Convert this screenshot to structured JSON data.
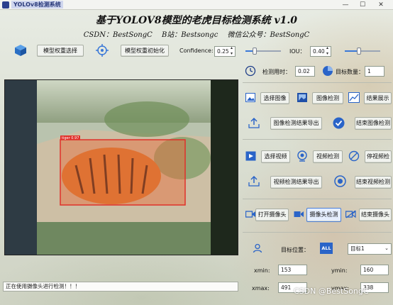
{
  "window": {
    "title": "YOLOv8检测系统"
  },
  "header": {
    "title": "基于YOLOV8模型的老虎目标检测系统 v1.0",
    "csdn": "CSDN：BestSongC",
    "bilibili": "B站：Bestsongc",
    "wechat": "微信公众号：BestSongC"
  },
  "model": {
    "select_label": "模型权重选择",
    "init_label": "模型权重初始化",
    "confidence_label": "Confidence:",
    "confidence_value": "0.25",
    "confidence_slider": 0.25,
    "iou_label": "IOU：",
    "iou_value": "0.40",
    "iou_slider": 0.4
  },
  "stats": {
    "time_label": "检测用时：",
    "time_value": "0.02",
    "count_label": "目标数量：",
    "count_value": "1"
  },
  "image_section": {
    "select": "选择图像",
    "detect": "图像检测",
    "show": "结果展示",
    "export": "图像检测结果导出",
    "end": "结束图像检测"
  },
  "video_section": {
    "select": "选择视频",
    "detect": "视频检测",
    "pause": "停视频检",
    "export": "视频检测结果导出",
    "end": "结束视频检测"
  },
  "camera_section": {
    "open": "打开摄像头",
    "detect": "摄像头检测",
    "close": "结束摄像头"
  },
  "target": {
    "position_label": "目标位置：",
    "all_icon_text": "ALL",
    "select_value": "目标1",
    "xmin_label": "xmin:",
    "xmin_value": "153",
    "ymin_label": "ymin:",
    "ymin_value": "160",
    "xmax_label": "xmax:",
    "xmax_value": "491",
    "ymax_label": "ymax:",
    "ymax_value": "338"
  },
  "detection": {
    "label": "tiger 0.97"
  },
  "status": {
    "text": "正在使用摄像头进行检测！！！"
  },
  "watermark": "CSDN @BestSongC",
  "colors": {
    "accent": "#3a78d8",
    "box": "#e0302a"
  }
}
